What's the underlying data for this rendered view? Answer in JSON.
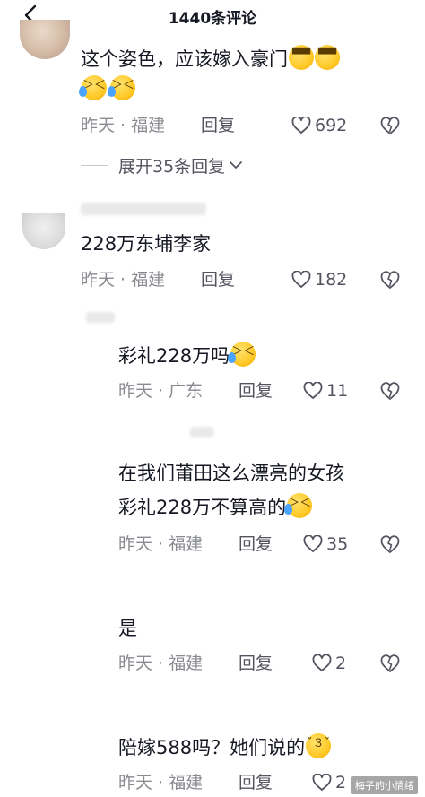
{
  "header": {
    "title": "1440条评论"
  },
  "comments": [
    {
      "text": "这个姿色，应该嫁入豪门",
      "time": "昨天",
      "location": "福建",
      "reply_label": "回复",
      "likes": "692"
    },
    {
      "text": "228万东埔李家",
      "time": "昨天",
      "location": "福建",
      "reply_label": "回复",
      "likes": "182"
    }
  ],
  "expand_label": "展开35条回复",
  "replies": [
    {
      "text": "彩礼228万吗",
      "time": "昨天",
      "location": "广东",
      "reply_label": "回复",
      "likes": "11"
    },
    {
      "line1": "在我们莆田这么漂亮的女孩",
      "line2": "彩礼228万不算高的",
      "time": "昨天",
      "location": "福建",
      "reply_label": "回复",
      "likes": "35"
    },
    {
      "text": "是",
      "time": "昨天",
      "location": "福建",
      "reply_label": "回复",
      "likes": "2"
    },
    {
      "text": "陪嫁588吗？她们说的",
      "time": "昨天",
      "location": "福建",
      "reply_label": "回复",
      "likes": "2"
    }
  ],
  "separator": "·",
  "watermark": "梅子的小情绪",
  "icons": {
    "back": "back-arrow-icon",
    "like": "heart-outline-icon",
    "dislike": "broken-heart-icon",
    "expand": "chevron-down-icon"
  },
  "colors": {
    "text": "#161823",
    "meta": "#8a8b91",
    "action": "#535460"
  }
}
